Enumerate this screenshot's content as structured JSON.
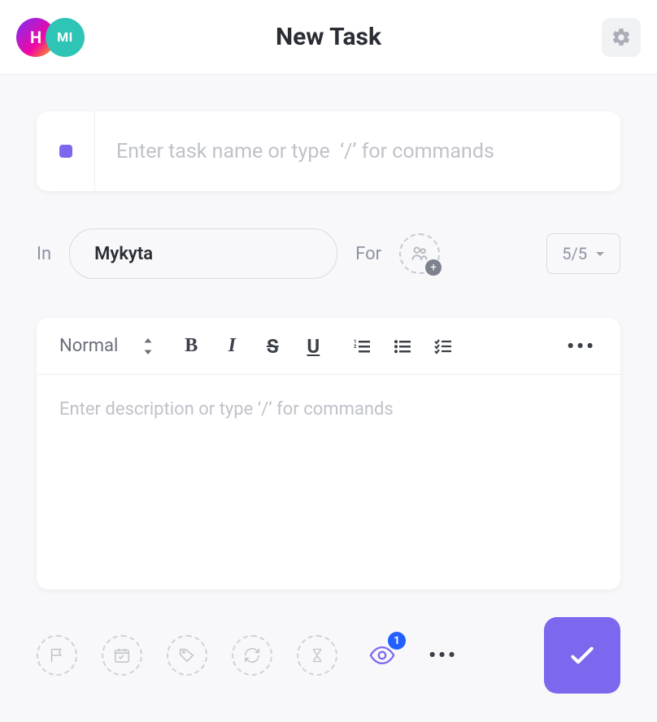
{
  "header": {
    "title": "New Task",
    "avatar1_letter": "H",
    "avatar2_letter": "MI"
  },
  "task": {
    "name_placeholder": "Enter task name or type  ‘/’ for commands",
    "name_value": ""
  },
  "location": {
    "in_label": "In",
    "folder": "Mykyta",
    "for_label": "For",
    "priority_label": "5/5"
  },
  "editor": {
    "format_label": "Normal",
    "description_placeholder": "Enter description or type ‘/’ for commands",
    "description_value": ""
  },
  "footer": {
    "watch_count": "1"
  }
}
